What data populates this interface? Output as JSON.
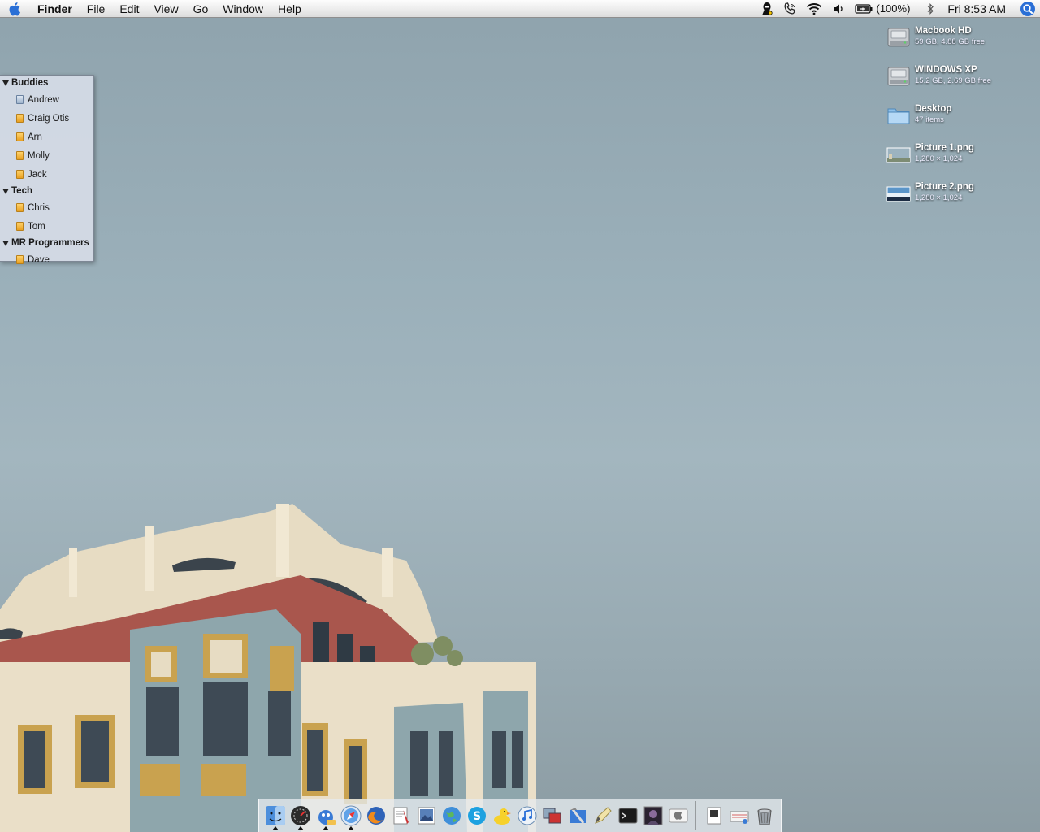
{
  "menubar": {
    "apple_icon": "apple-logo-icon",
    "app_name": "Finder",
    "menus": [
      "File",
      "Edit",
      "View",
      "Go",
      "Window",
      "Help"
    ],
    "tray_icons": [
      "spy-agent-icon",
      "phone-icon",
      "wifi-icon",
      "volume-icon",
      "battery-icon",
      "bluetooth-icon"
    ],
    "battery": "(100%)",
    "clock": "Fri 8:53 AM",
    "spotlight_icon": "spotlight-search-icon"
  },
  "buddy_list": {
    "groups": [
      {
        "name": "Buddies",
        "buddies": [
          {
            "name": "Andrew",
            "status": "mobile"
          },
          {
            "name": "Craig Otis",
            "status": "online"
          },
          {
            "name": "Arn",
            "status": "online"
          },
          {
            "name": "Molly",
            "status": "online"
          },
          {
            "name": "Jack",
            "status": "online"
          }
        ]
      },
      {
        "name": "Tech",
        "buddies": [
          {
            "name": "Chris",
            "status": "online"
          },
          {
            "name": "Tom",
            "status": "online"
          }
        ]
      },
      {
        "name": "MR Programmers",
        "buddies": [
          {
            "name": "Dave",
            "status": "online"
          }
        ]
      }
    ]
  },
  "desktop_icons": [
    {
      "name": "Macbook HD",
      "meta": "59 GB, 4.88 GB free",
      "icon": "hard-drive-icon"
    },
    {
      "name": "WINDOWS XP",
      "meta": "15.2 GB, 2.69 GB free",
      "icon": "hard-drive-icon"
    },
    {
      "name": "Desktop",
      "meta": "47 items",
      "icon": "folder-icon"
    },
    {
      "name": "Picture 1.png",
      "meta": "1,280 × 1,024",
      "icon": "image-thumbnail-icon"
    },
    {
      "name": "Picture 2.png",
      "meta": "1,280 × 1,024",
      "icon": "image-thumbnail-icon"
    }
  ],
  "dock": {
    "apps": [
      {
        "icon": "finder-icon",
        "running": true
      },
      {
        "icon": "dashboard-icon",
        "running": true
      },
      {
        "icon": "adium-icon",
        "running": true
      },
      {
        "icon": "safari-icon",
        "running": true
      },
      {
        "icon": "firefox-icon",
        "running": false
      },
      {
        "icon": "textedit-icon",
        "running": false
      },
      {
        "icon": "preview-icon",
        "running": false
      },
      {
        "icon": "network-globe-icon",
        "running": false
      },
      {
        "icon": "skype-icon",
        "running": false
      },
      {
        "icon": "cyberduck-icon",
        "running": false
      },
      {
        "icon": "itunes-icon",
        "running": false
      },
      {
        "icon": "parallels-icon",
        "running": false
      },
      {
        "icon": "xcode-icon",
        "running": false
      },
      {
        "icon": "pen-tool-icon",
        "running": false
      },
      {
        "icon": "terminal-icon",
        "running": false
      },
      {
        "icon": "game-icon",
        "running": false
      },
      {
        "icon": "apple-app-icon",
        "running": false
      }
    ],
    "docs": [
      {
        "icon": "document-icon"
      },
      {
        "icon": "downloads-icon"
      },
      {
        "icon": "trash-icon"
      }
    ]
  },
  "colors": {
    "sky": "#9bb0ba",
    "menubar": "#ececec",
    "accent": "#2a6fd6"
  }
}
